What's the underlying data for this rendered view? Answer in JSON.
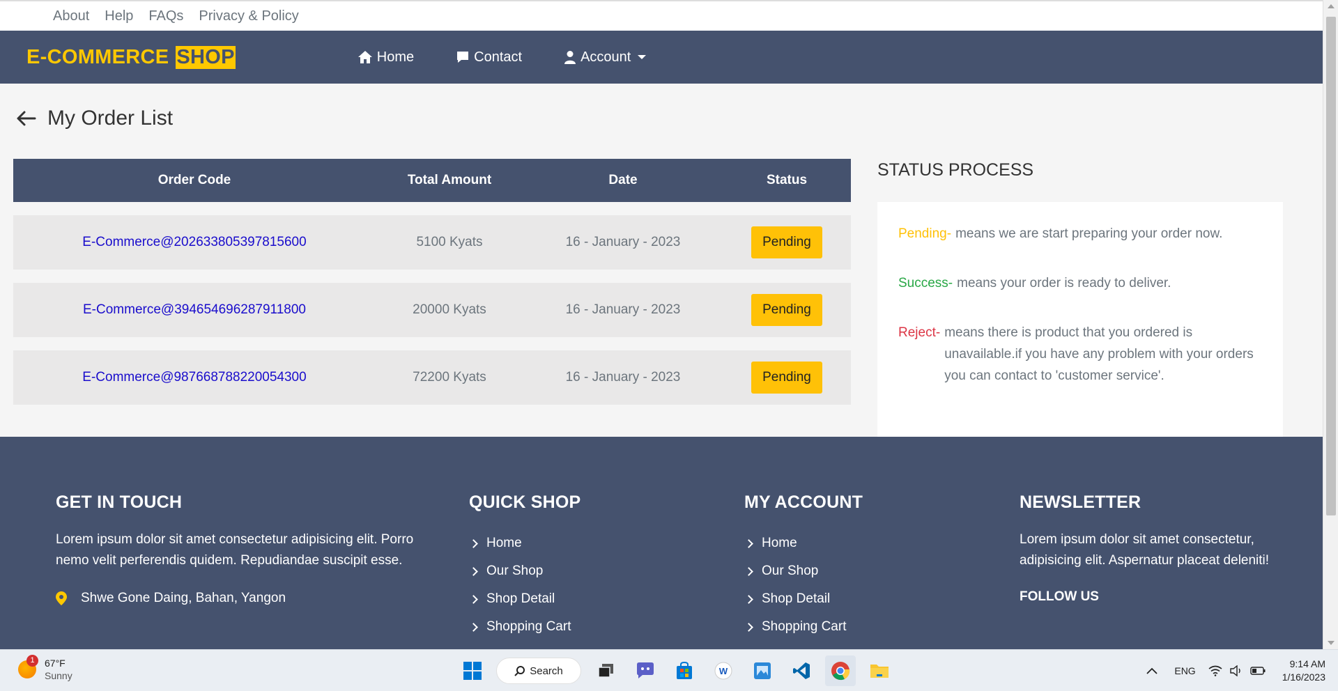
{
  "topbar": {
    "links": [
      "About",
      "Help",
      "FAQs",
      "Privacy & Policy"
    ]
  },
  "navbar": {
    "logo_main": "E-COMMERCE",
    "logo_highlight": "SHOP",
    "home": "Home",
    "contact": "Contact",
    "account": "Account"
  },
  "page": {
    "title": "My Order List"
  },
  "orders": {
    "headers": {
      "code": "Order Code",
      "amount": "Total Amount",
      "date": "Date",
      "status": "Status"
    },
    "rows": [
      {
        "code": "E-Commerce@202633805397815600",
        "amount": "5100 Kyats",
        "date": "16 - January - 2023",
        "status": "Pending"
      },
      {
        "code": "E-Commerce@394654696287911800",
        "amount": "20000 Kyats",
        "date": "16 - January - 2023",
        "status": "Pending"
      },
      {
        "code": "E-Commerce@987668788220054300",
        "amount": "72200 Kyats",
        "date": "16 - January - 2023",
        "status": "Pending"
      }
    ]
  },
  "status_process": {
    "title": "STATUS PROCESS",
    "pending_key": "Pending-",
    "pending_text": "means we are start preparing your order now.",
    "success_key": "Success-",
    "success_text": "means your order is ready to deliver.",
    "reject_key": "Reject-",
    "reject_text": "means there is product that you ordered is unavailable.if you have any problem with your orders you can contact to 'customer service'."
  },
  "footer": {
    "touch_title": "GET IN TOUCH",
    "touch_text": "Lorem ipsum dolor sit amet consectetur adipisicing elit. Porro nemo velit perferendis quidem. Repudiandae suscipit esse.",
    "address": "Shwe Gone Daing, Bahan, Yangon",
    "quick_title": "QUICK SHOP",
    "quick_links": [
      "Home",
      "Our Shop",
      "Shop Detail",
      "Shopping Cart"
    ],
    "account_title": "MY ACCOUNT",
    "account_links": [
      "Home",
      "Our Shop",
      "Shop Detail",
      "Shopping Cart"
    ],
    "newsletter_title": "NEWSLETTER",
    "newsletter_text": "Lorem ipsum dolor sit amet consectetur, adipisicing elit. Aspernatur placeat deleniti!",
    "follow": "FOLLOW US"
  },
  "taskbar": {
    "weather_badge": "1",
    "temp": "67°F",
    "condition": "Sunny",
    "search": "Search",
    "lang": "ENG",
    "time": "9:14 AM",
    "date": "1/16/2023"
  },
  "colors": {
    "navy": "#45526e",
    "yellow": "#ffc800",
    "badge": "#ffc107",
    "link": "#1a0dcc"
  }
}
